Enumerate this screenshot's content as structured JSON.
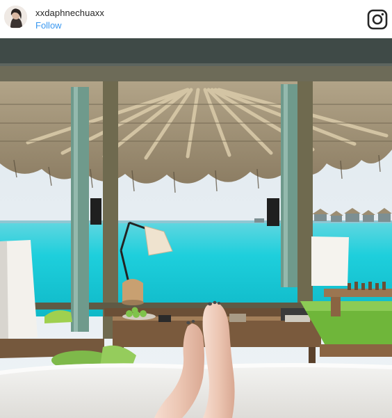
{
  "post": {
    "username": "xxdaphnechuaxx",
    "follow_label": "Follow"
  },
  "icons": {
    "avatar": "profile-avatar",
    "brand": "instagram-icon"
  },
  "colors": {
    "follow_link": "#3897f0",
    "username_text": "#262626",
    "sea": "#22d3dc"
  },
  "photo": {
    "subject": "overwater villa view: bare feet resting on bed, thatched roof, turquoise lagoon"
  }
}
